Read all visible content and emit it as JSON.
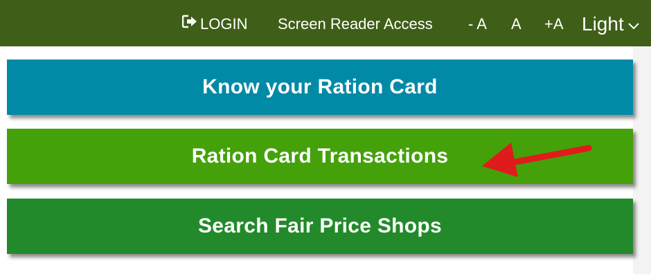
{
  "header": {
    "login_label": "LOGIN",
    "screen_reader_label": "Screen Reader Access",
    "font_decrease_label": "- A",
    "font_normal_label": "A",
    "font_increase_label": "+A",
    "theme_label": "Light"
  },
  "menu": {
    "items": [
      {
        "label": "Know your Ration Card"
      },
      {
        "label": "Ration Card Transactions"
      },
      {
        "label": "Search Fair Price Shops"
      }
    ]
  },
  "icons": {
    "login": "sign-in-icon",
    "theme_dropdown": "chevron-down-icon",
    "annotation": "red-arrow-annotation"
  },
  "colors": {
    "topbar": "#3f5f18",
    "know_card": "#008aa6",
    "transactions": "#44a10a",
    "search_shops": "#228a2a",
    "arrow": "#e01b1b"
  }
}
